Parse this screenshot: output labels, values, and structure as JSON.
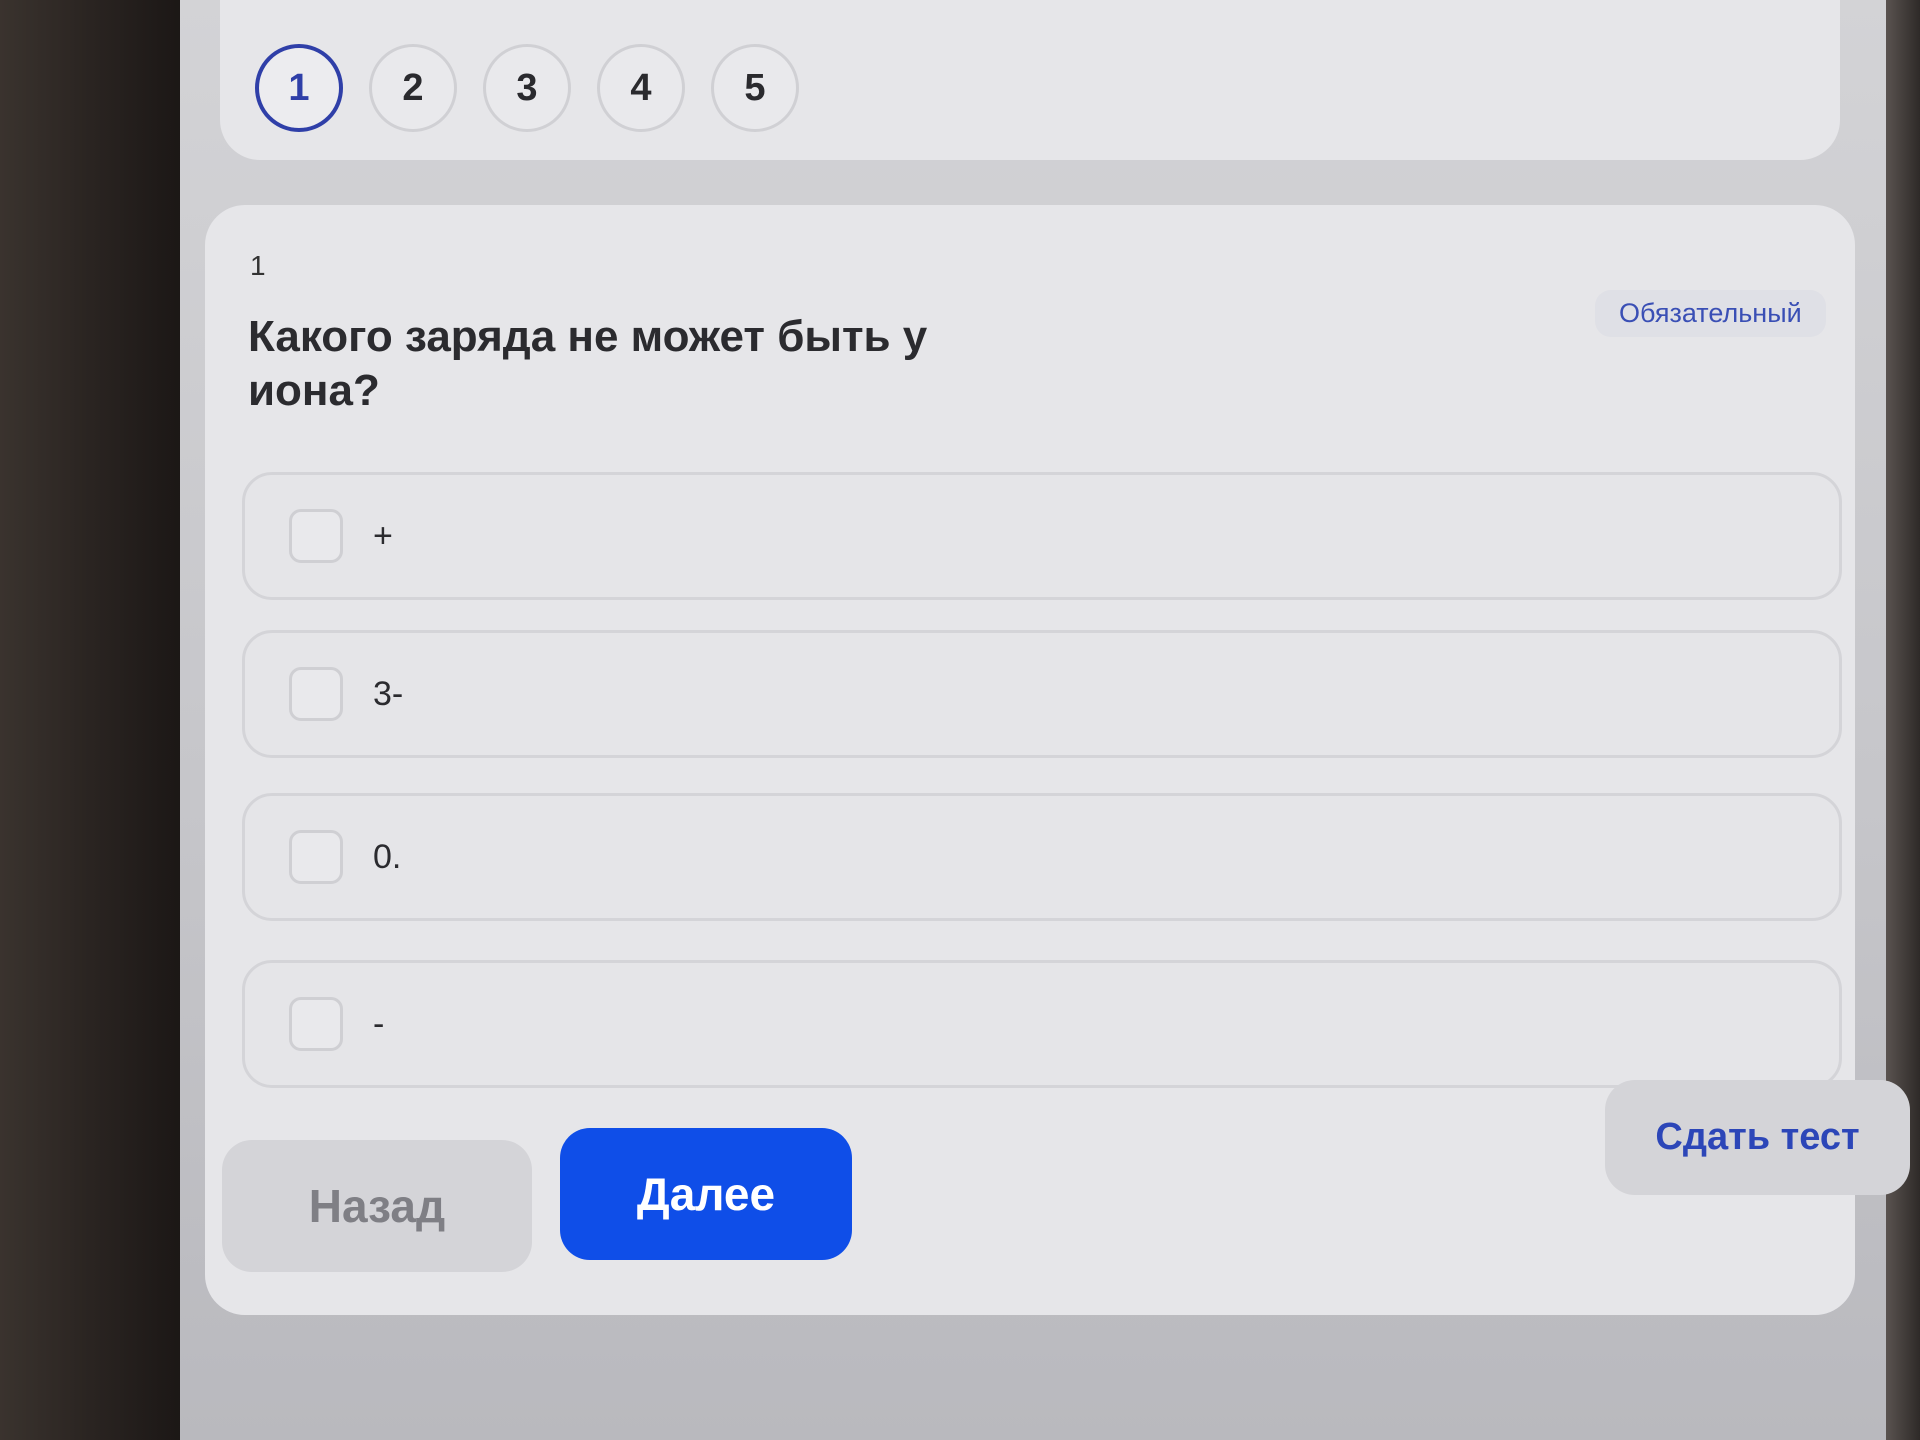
{
  "steps": [
    "1",
    "2",
    "3",
    "4",
    "5"
  ],
  "question": {
    "number": "1",
    "text": "Какого заряда не может быть у иона?",
    "required_badge": "Обязательный"
  },
  "options": [
    "+",
    "3-",
    "0.",
    "-"
  ],
  "buttons": {
    "back": "Назад",
    "next": "Далее",
    "submit": "Сдать тест"
  },
  "colors": {
    "accent": "#0f4ee8",
    "active_step": "#2f3fa8",
    "link": "#2c46b8"
  }
}
